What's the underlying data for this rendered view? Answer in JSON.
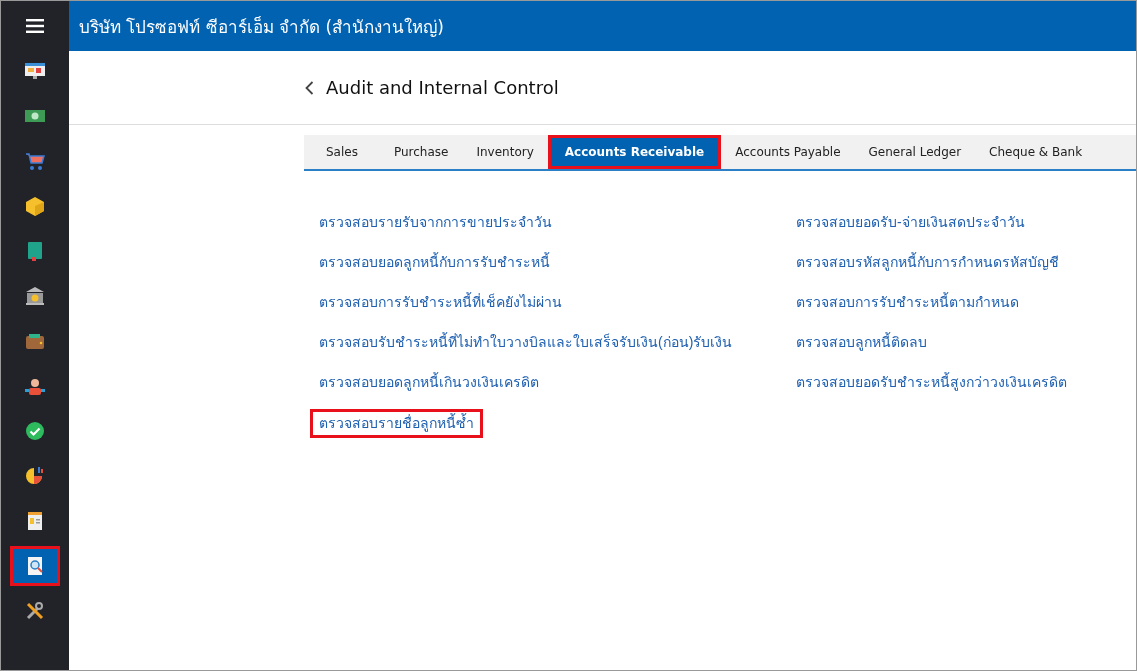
{
  "header": {
    "title": "บริษัท โปรซอฟท์ ซีอาร์เอ็ม จำกัด (สำนักงานใหญ่)"
  },
  "sidebar": {
    "items": [
      {
        "selected": false,
        "highlighted": false
      },
      {
        "selected": false,
        "highlighted": false
      },
      {
        "selected": false,
        "highlighted": false
      },
      {
        "selected": false,
        "highlighted": false
      },
      {
        "selected": false,
        "highlighted": false
      },
      {
        "selected": false,
        "highlighted": false
      },
      {
        "selected": false,
        "highlighted": false
      },
      {
        "selected": false,
        "highlighted": false
      },
      {
        "selected": false,
        "highlighted": false
      },
      {
        "selected": false,
        "highlighted": false
      },
      {
        "selected": false,
        "highlighted": false
      },
      {
        "selected": true,
        "highlighted": true
      },
      {
        "selected": false,
        "highlighted": false
      }
    ]
  },
  "page": {
    "title": "Audit and Internal Control"
  },
  "tabs": [
    {
      "label": "Sales",
      "selected": false,
      "highlighted": false
    },
    {
      "label": "Purchase",
      "selected": false,
      "highlighted": false
    },
    {
      "label": "Inventory",
      "selected": false,
      "highlighted": false
    },
    {
      "label": "Accounts Receivable",
      "selected": true,
      "highlighted": true
    },
    {
      "label": "Accounts Payable",
      "selected": false,
      "highlighted": false
    },
    {
      "label": "General Ledger",
      "selected": false,
      "highlighted": false
    },
    {
      "label": "Cheque & Bank",
      "selected": false,
      "highlighted": false
    }
  ],
  "links_left": [
    {
      "label": "ตรวจสอบรายรับจากการขายประจำวัน",
      "highlighted": false
    },
    {
      "label": "ตรวจสอบยอดลูกหนี้กับการรับชำระหนี้",
      "highlighted": false
    },
    {
      "label": "ตรวจสอบการรับชำระหนี้ที่เช็คยังไม่ผ่าน",
      "highlighted": false
    },
    {
      "label": "ตรวจสอบรับชำระหนี้ที่ไม่ทำใบวางบิลและใบเสร็จรับเงิน(ก่อน)รับเงิน",
      "highlighted": false
    },
    {
      "label": "ตรวจสอบยอดลูกหนี้เกินวงเงินเครดิต",
      "highlighted": false
    },
    {
      "label": "ตรวจสอบรายชื่อลูกหนี้ซ้ำ",
      "highlighted": true
    }
  ],
  "links_right": [
    {
      "label": "ตรวจสอบยอดรับ-จ่ายเงินสดประจำวัน",
      "highlighted": false
    },
    {
      "label": "ตรวจสอบรหัสลูกหนี้กับการกำหนดรหัสบัญชี",
      "highlighted": false
    },
    {
      "label": "ตรวจสอบการรับชำระหนี้ตามกำหนด",
      "highlighted": false
    },
    {
      "label": "ตรวจสอบลูกหนี้ติดลบ",
      "highlighted": false
    },
    {
      "label": "ตรวจสอบยอดรับชำระหนี้สูงกว่าวงเงินเครดิต",
      "highlighted": false
    }
  ]
}
